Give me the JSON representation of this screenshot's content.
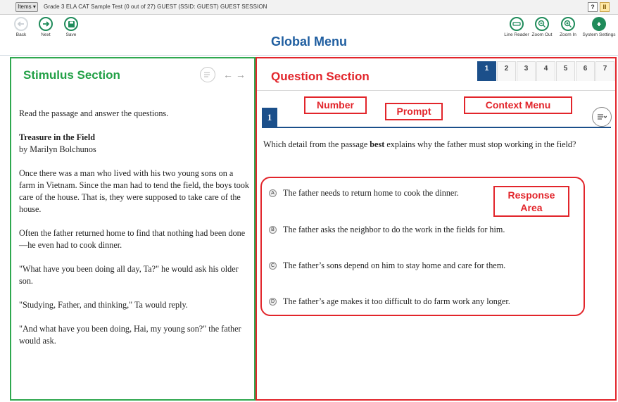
{
  "topbar": {
    "items_label": "Items",
    "session_info": "Grade 3 ELA CAT Sample Test (0 out of 27)   GUEST (SSID: GUEST)   GUEST SESSION",
    "help_label": "?",
    "pause_label": "II"
  },
  "toolbar": {
    "title": "Global Menu",
    "back_label": "Back",
    "next_label": "Next",
    "save_label": "Save",
    "line_reader_label": "Line Reader",
    "zoom_out_label": "Zoom Out",
    "zoom_in_label": "Zoom In",
    "system_settings_label": "System Settings"
  },
  "stimulus": {
    "section_label": "Stimulus Section",
    "intro": "Read the passage and answer the questions.",
    "title": "Treasure in the Field",
    "author": "by Marilyn Bolchunos",
    "paragraphs": [
      "Once there was a man who lived with his two young sons on a farm in Vietnam. Since the man had to tend the field, the boys took care of the house. That is, they were supposed to take care of the house.",
      "Often the father returned home to find that nothing had been done—he even had to cook dinner.",
      "\"What have you been doing all day, Ta?\" he would ask his older son.",
      "\"Studying, Father, and thinking,\" Ta would reply.",
      "\"And what have you been doing, Hai, my young son?\" the father would ask."
    ]
  },
  "question": {
    "section_label": "Question Section",
    "tabs": [
      "1",
      "2",
      "3",
      "4",
      "5",
      "6",
      "7"
    ],
    "active_tab": "1",
    "number": "1",
    "prompt_before": "Which detail from the passage ",
    "prompt_bold": "best",
    "prompt_after": " explains why the father must stop working in the field?",
    "options": [
      {
        "letter": "A",
        "text": "The father needs to return home to cook the dinner."
      },
      {
        "letter": "B",
        "text": "The father asks the neighbor to do the work in the fields for him."
      },
      {
        "letter": "C",
        "text": "The father’s sons depend on him to stay home and care for them."
      },
      {
        "letter": "D",
        "text": "The father’s age makes it too difficult to do farm work any longer."
      }
    ]
  },
  "callouts": {
    "number": "Number",
    "prompt": "Prompt",
    "context_menu": "Context Menu",
    "response_line1": "Response",
    "response_line2": "Area"
  },
  "colors": {
    "stimulus_accent": "#2fa84f",
    "question_accent": "#e2252b",
    "brand_blue": "#1f5ea0",
    "nav_green": "#1f8b5a"
  },
  "icons": [
    "back-arrow-icon",
    "next-arrow-icon",
    "save-disk-icon",
    "line-reader-icon",
    "zoom-out-icon",
    "zoom-in-icon",
    "system-settings-icon",
    "context-menu-icon",
    "collapse-arrows-icon"
  ]
}
